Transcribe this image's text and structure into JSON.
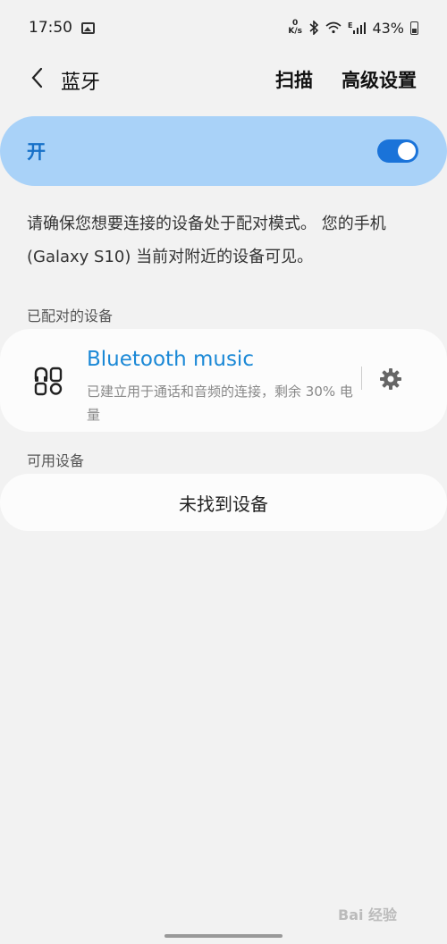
{
  "status_bar": {
    "time": "17:50",
    "speed_top": "0",
    "speed_unit": "K/s",
    "network_type": "E",
    "battery_percent": "43%"
  },
  "header": {
    "title": "蓝牙",
    "scan_label": "扫描",
    "advanced_label": "高级设置"
  },
  "bluetooth_toggle": {
    "label": "开",
    "state": "on",
    "accent_color": "#1a73d9",
    "background_color": "#a9d2f8"
  },
  "description": "请确保您想要连接的设备处于配对模式。 您的手机 (Galaxy S10) 当前对附近的设备可见。",
  "paired_section": {
    "header": "已配对的设备",
    "devices": [
      {
        "name": "Bluetooth music",
        "status": "已建立用于通话和音频的连接，剩余 30% 电量",
        "icon": "headphones-speaker-icon"
      }
    ]
  },
  "available_section": {
    "header": "可用设备",
    "empty_text": "未找到设备"
  },
  "watermark": {
    "text": "Bai 经验"
  }
}
